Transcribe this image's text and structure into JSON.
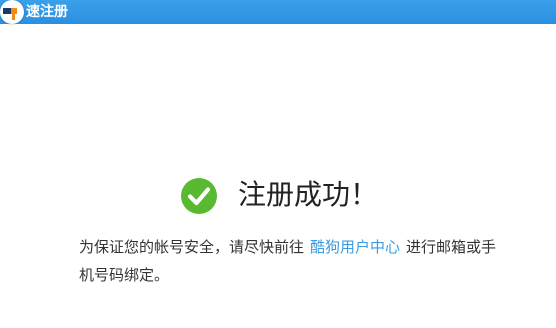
{
  "window": {
    "title": "速注册"
  },
  "result": {
    "title": "注册成功！",
    "icon": "check-circle-icon",
    "icon_color": "#59b930"
  },
  "notice": {
    "prefix": "为保证您的帐号安全，请尽快前往",
    "link_text": "酷狗用户中心",
    "suffix": "进行邮箱或手机号码绑定。",
    "link_color": "#3b9be0"
  },
  "colors": {
    "titlebar": "#2b8fe0"
  }
}
